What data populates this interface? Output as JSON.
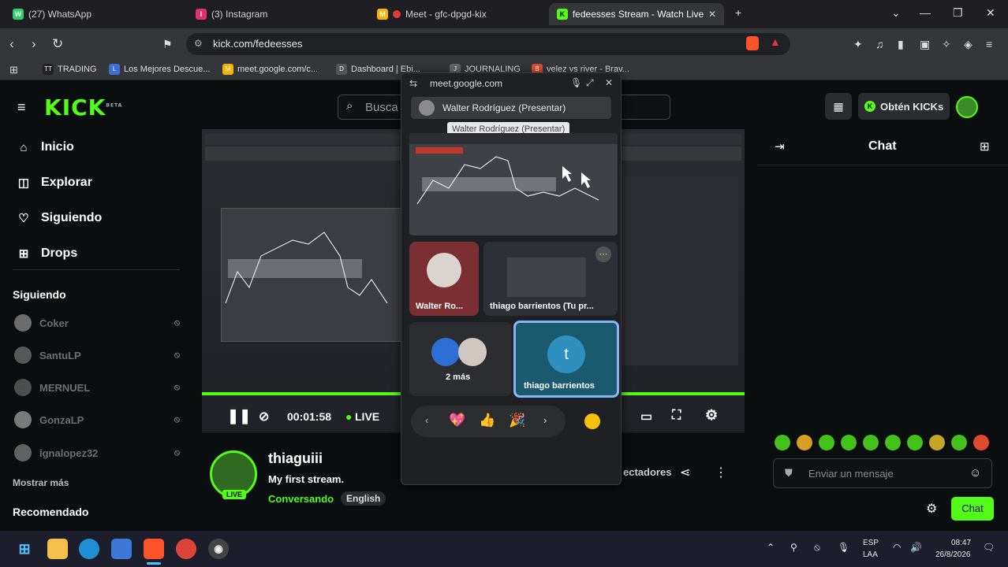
{
  "browser": {
    "tabs": [
      {
        "label": "(27) WhatsApp",
        "color": "#25d366",
        "glyph": "W"
      },
      {
        "label": "(3) Instagram",
        "color": "#e1306c",
        "glyph": "I"
      },
      {
        "label": "Meet - gfc-dpgd-kix",
        "color": "#f4b400",
        "glyph": "M"
      },
      {
        "label": "fedeesses Stream - Watch Live o",
        "color": "#53fc18",
        "glyph": "K"
      }
    ],
    "new_tab": "+",
    "url": "kick.com/fedeesses",
    "bookmarks": [
      {
        "label": "TRADING",
        "color": "#222",
        "glyph": "TT"
      },
      {
        "label": "Los Mejores Descue...",
        "color": "#3b6fd6",
        "glyph": "L"
      },
      {
        "label": "meet.google.com/c...",
        "color": "#f4b400",
        "glyph": "M"
      },
      {
        "label": "Dashboard | Ebi...",
        "color": "#555",
        "glyph": "D"
      },
      {
        "label": "JOURNALING",
        "color": "#666",
        "glyph": "J"
      },
      {
        "label": "velez vs river - Brav...",
        "color": "#e04a2f",
        "glyph": "B"
      }
    ]
  },
  "kick": {
    "logo": "KICK",
    "logo_beta": "BETA",
    "search_placeholder": "Busca",
    "get_kicks": "Obtén KICKs",
    "nav": [
      {
        "label": "Inicio",
        "icon": "home-icon",
        "glyph": "⌂"
      },
      {
        "label": "Explorar",
        "icon": "compass-icon",
        "glyph": "◫"
      },
      {
        "label": "Siguiendo",
        "icon": "heart-icon",
        "glyph": "♡"
      },
      {
        "label": "Drops",
        "icon": "gift-icon",
        "glyph": "⊞"
      }
    ],
    "following_title": "Siguiendo",
    "following": [
      "Coker",
      "SantuLP",
      "MERNUEL",
      "GonzaLP",
      "ignalopez32"
    ],
    "show_more": "Mostrar más",
    "recommended_title": "Recomendado",
    "player": {
      "time": "00:01:58",
      "live": "LIVE"
    },
    "streamer": {
      "name": "thiaguiii",
      "title": "My first stream.",
      "category": "Conversando",
      "tag": "English",
      "live_badge": "LIVE",
      "viewers_label": "ectadores"
    },
    "chat": {
      "title": "Chat",
      "input_placeholder": "Enviar un mensaje",
      "send_label": "Chat"
    }
  },
  "meet": {
    "header_url": "meet.google.com",
    "presenter_bar": "Walter Rodríguez (Presentar)",
    "tooltip": "Walter Rodríguez (Presentar)",
    "tiles": [
      {
        "label": "Walter Ro..."
      },
      {
        "label": "thiago barrientos (Tu pr..."
      },
      {
        "label": "2 más"
      },
      {
        "label": "thiago barrientos",
        "initial": "t"
      }
    ],
    "reactions": [
      "💖",
      "👍",
      "🎉"
    ]
  },
  "taskbar": {
    "lang_top": "ESP",
    "lang_bottom": "LAA",
    "time": "08:47",
    "date": "26/8/2026"
  }
}
